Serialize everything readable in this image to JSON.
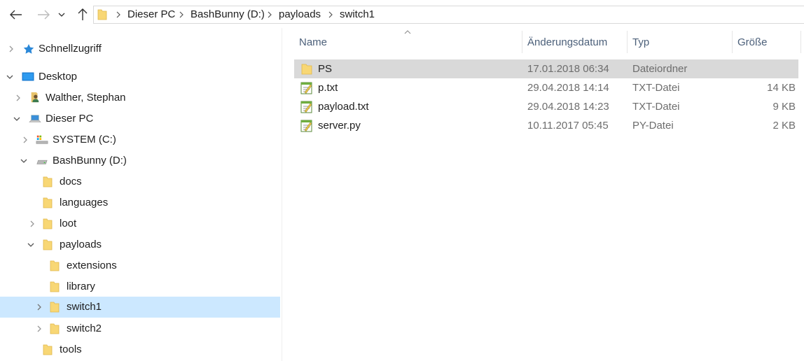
{
  "breadcrumb": {
    "items": [
      "Dieser PC",
      "BashBunny (D:)",
      "payloads",
      "switch1"
    ]
  },
  "tree": {
    "items": [
      {
        "label": "Schnellzugriff",
        "icon": "star-icon",
        "expand": "collapsed"
      },
      {
        "label": "Desktop",
        "icon": "desktop-icon",
        "expand": "expanded"
      },
      {
        "label": "Walther, Stephan",
        "icon": "user-icon",
        "expand": "collapsed"
      },
      {
        "label": "Dieser PC",
        "icon": "computer-icon",
        "expand": "expanded"
      },
      {
        "label": "SYSTEM (C:)",
        "icon": "system-drive-icon",
        "expand": "collapsed"
      },
      {
        "label": "BashBunny (D:)",
        "icon": "drive-icon",
        "expand": "expanded"
      },
      {
        "label": "docs",
        "icon": "folder-icon",
        "expand": "none"
      },
      {
        "label": "languages",
        "icon": "folder-icon",
        "expand": "none"
      },
      {
        "label": "loot",
        "icon": "folder-icon",
        "expand": "collapsed"
      },
      {
        "label": "payloads",
        "icon": "folder-icon",
        "expand": "expanded"
      },
      {
        "label": "extensions",
        "icon": "folder-icon",
        "expand": "none"
      },
      {
        "label": "library",
        "icon": "folder-icon",
        "expand": "none"
      },
      {
        "label": "switch1",
        "icon": "folder-icon",
        "expand": "collapsed",
        "selected": true
      },
      {
        "label": "switch2",
        "icon": "folder-icon",
        "expand": "collapsed"
      },
      {
        "label": "tools",
        "icon": "folder-icon",
        "expand": "none"
      }
    ]
  },
  "columns": {
    "name": "Name",
    "date": "Änderungsdatum",
    "type": "Typ",
    "size": "Größe"
  },
  "files": [
    {
      "name": "PS",
      "date": "17.01.2018 06:34",
      "type": "Dateiordner",
      "size": "",
      "icon": "folder-icon",
      "selected": true
    },
    {
      "name": "p.txt",
      "date": "29.04.2018 14:14",
      "type": "TXT-Datei",
      "size": "14 KB",
      "icon": "text-file-icon"
    },
    {
      "name": "payload.txt",
      "date": "29.04.2018 14:23",
      "type": "TXT-Datei",
      "size": "9 KB",
      "icon": "text-file-icon"
    },
    {
      "name": "server.py",
      "date": "10.11.2017 05:45",
      "type": "PY-Datei",
      "size": "2 KB",
      "icon": "text-file-icon"
    }
  ],
  "colors": {
    "tree_selected": "#cce8ff",
    "row_selected": "#d9d9d9",
    "folder": "#f8d775",
    "header_text": "#4c607a"
  }
}
